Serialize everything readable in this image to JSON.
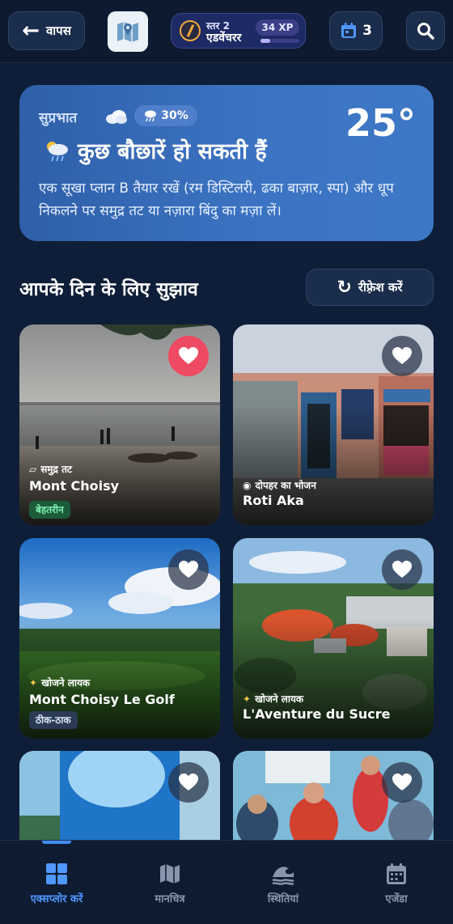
{
  "header": {
    "back_label": "वापस",
    "level_small": "स्तर 2",
    "level_name": "एडवेंचरर",
    "xp": "34 XP",
    "xp_progress": 0.25,
    "calendar_count": "3"
  },
  "weather": {
    "greeting": "सुप्रभात",
    "rain_chance": "30%",
    "temperature": "25°",
    "headline": "कुछ बौछारें हो सकती हैं",
    "description": "एक सूखा प्लान B तैयार रखें (रम डिस्टिलरी, ढका बाज़ार, स्पा) और धूप निकलने पर समुद्र तट या नज़ारा बिंदु का मज़ा लें।"
  },
  "suggestions": {
    "title": "आपके दिन के लिए सुझाव",
    "refresh_label": "रीफ़्रेश करें",
    "cards": [
      {
        "category": "समुद्र तट",
        "name": "Mont Choisy",
        "tag": "बेहतरीन",
        "favorited": true
      },
      {
        "category": "दोपहर का भोजन",
        "name": "Roti Aka",
        "favorited": false
      },
      {
        "category": "खोजने लायक",
        "name": "Mont Choisy Le Golf",
        "tag": "ठीक-ठाक",
        "favorited": false
      },
      {
        "category": "खोजने लायक",
        "name": "L'Aventure du Sucre",
        "favorited": false
      },
      {
        "favorited": false
      },
      {
        "favorited": false
      }
    ]
  },
  "nav": {
    "items": [
      {
        "label": "एक्सप्लोर करें",
        "active": true
      },
      {
        "label": "मानचित्र",
        "active": false
      },
      {
        "label": "स्थितियां",
        "active": false
      },
      {
        "label": "एजेंडा",
        "active": false
      }
    ]
  },
  "colors": {
    "background": "#0f1e38",
    "accent": "#4f97ff",
    "favorite": "#ef4a63"
  }
}
